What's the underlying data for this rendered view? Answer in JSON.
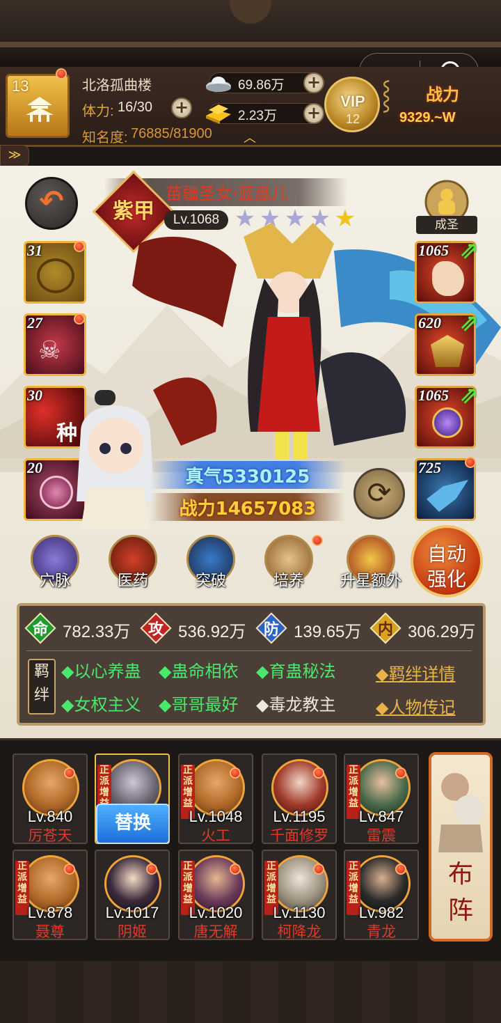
{
  "header": {
    "player_level": "13",
    "player_name": "北洛孤曲楼",
    "stamina_label": "体力:",
    "stamina_value": "16/30",
    "fame_label": "知名度:",
    "fame_value": "76885/81900",
    "silver": "69.86万",
    "gold": "2.23万",
    "vip_label": "VIP",
    "vip_level": "12",
    "power_label": "战力",
    "power_value": "9329.~W"
  },
  "hero": {
    "rank_badge": "紫甲",
    "name": "苗疆圣女·蓝凰儿",
    "level": "Lv.1068",
    "stars_total": 5,
    "stars_gold": 1,
    "saint_label": "成圣",
    "qi_text": "真气5330125",
    "power_text": "战力14657083"
  },
  "skill_slots": [
    {
      "num": "31",
      "color": "#8a6a1c"
    },
    {
      "num": "27",
      "color": "#5a1a2a"
    },
    {
      "num": "30",
      "color": "#6a0c10",
      "char": "种"
    },
    {
      "num": "20",
      "color": "#5a1830"
    }
  ],
  "equipment": [
    {
      "num": "1065",
      "color": "#7a2418"
    },
    {
      "num": "620",
      "color": "#7a2418"
    },
    {
      "num": "1065",
      "color": "#7a2418"
    },
    {
      "num": "725",
      "color": "#1c3a5a"
    }
  ],
  "actions": [
    {
      "label": "穴脉",
      "icon": "meridian-icon"
    },
    {
      "label": "医药",
      "icon": "medicine-icon"
    },
    {
      "label": "突破",
      "icon": "breakthrough-icon"
    },
    {
      "label": "培养",
      "icon": "training-icon"
    },
    {
      "label": "升星额外",
      "icon": "star-up-icon"
    }
  ],
  "auto_enhance": {
    "line1": "自动",
    "line2": "强化"
  },
  "stats": [
    {
      "char": "命",
      "value": "782.33万",
      "color": "#1f9a2c"
    },
    {
      "char": "攻",
      "value": "536.92万",
      "color": "#c22424"
    },
    {
      "char": "防",
      "value": "139.65万",
      "color": "#2a62c6"
    },
    {
      "char": "内",
      "value": "306.29万",
      "color": "#d9a21f"
    }
  ],
  "bond_tag": "羁绊",
  "bonds": [
    {
      "text": "◆以心养蛊",
      "active": true
    },
    {
      "text": "◆蛊命相依",
      "active": true
    },
    {
      "text": "◆育蛊秘法",
      "active": true
    },
    {
      "text": "◆女权主义",
      "active": true
    },
    {
      "text": "◆哥哥最好",
      "active": true
    },
    {
      "text": "◆毒龙教主",
      "active": false
    }
  ],
  "links": {
    "bond_detail": "◆羁绊详情",
    "biography": "◆人物传记"
  },
  "roster": [
    {
      "level": "Lv.840",
      "name": "厉苍天",
      "tag": ""
    },
    {
      "level": "",
      "name": "",
      "tag": "正派增益",
      "selected": true
    },
    {
      "level": "Lv.1048",
      "name": "火工",
      "tag": "正派增益"
    },
    {
      "level": "Lv.1195",
      "name": "千面修罗",
      "tag": ""
    },
    {
      "level": "Lv.847",
      "name": "雷震",
      "tag": "正派增益"
    },
    {
      "level": "Lv.878",
      "name": "聂尊",
      "tag": "正派增益"
    },
    {
      "level": "Lv.1017",
      "name": "阴姬",
      "tag": ""
    },
    {
      "level": "Lv.1020",
      "name": "唐无解",
      "tag": "正派增益"
    },
    {
      "level": "Lv.1130",
      "name": "柯降龙",
      "tag": "正派增益"
    },
    {
      "level": "Lv.982",
      "name": "青龙",
      "tag": "正派增益"
    }
  ],
  "replace_label": "替换",
  "formation_label": "布阵"
}
